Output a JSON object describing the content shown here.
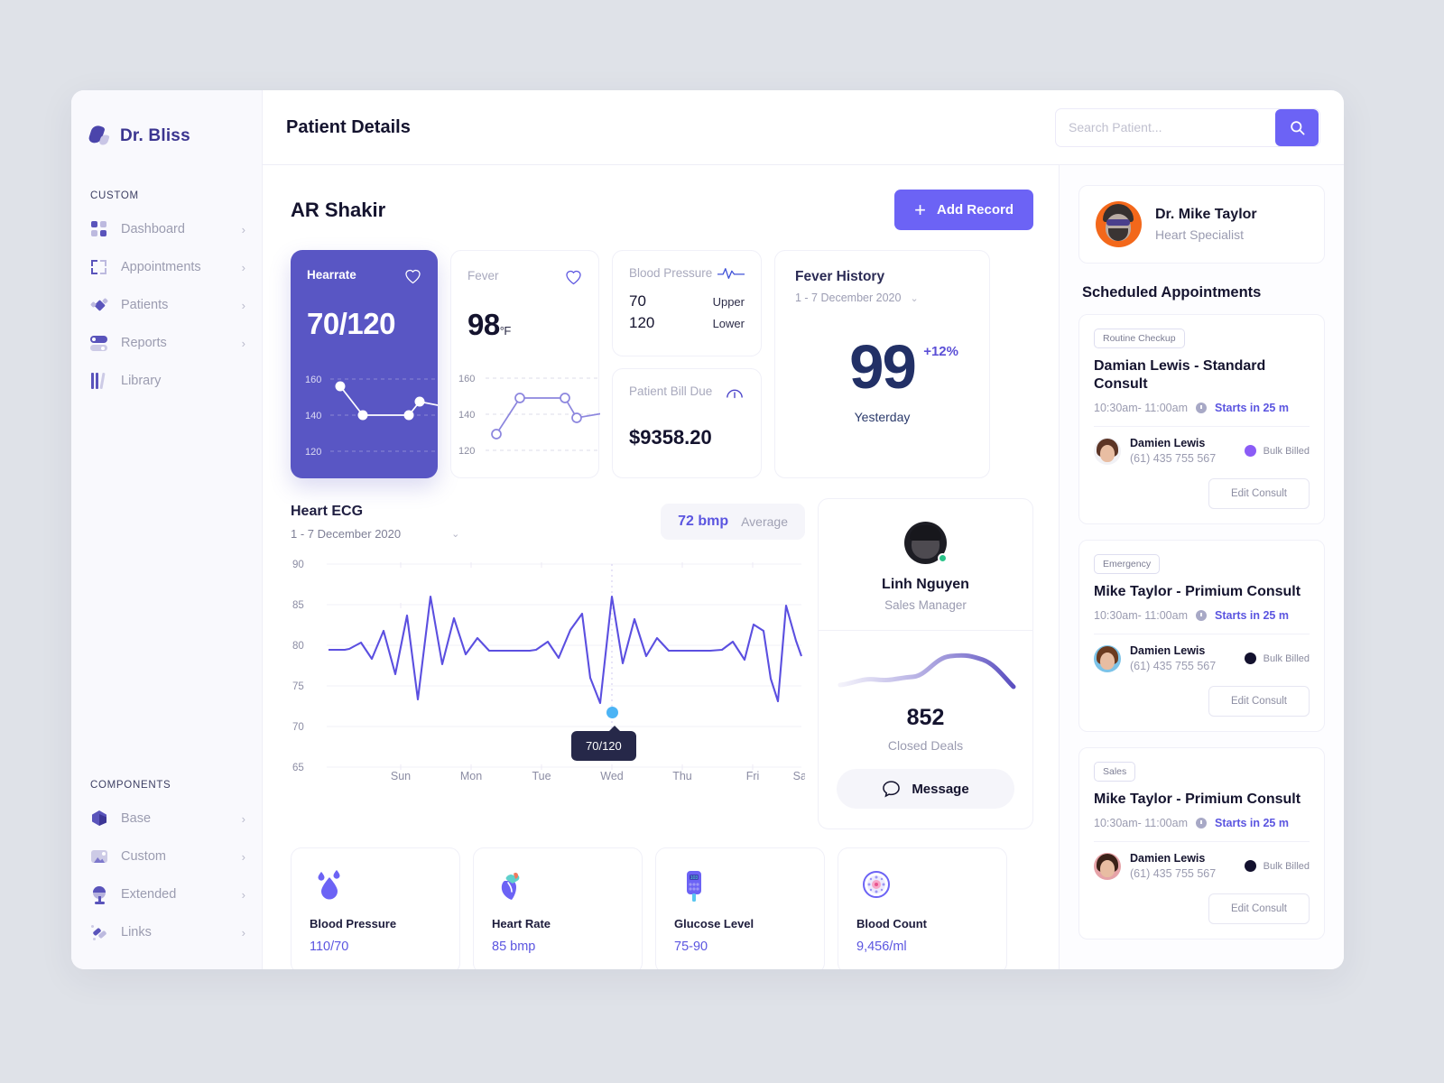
{
  "brand": {
    "name": "Dr. Bliss",
    "logo_icon": "leaf-logo-icon"
  },
  "sidebar": {
    "group1_label": "CUSTOM",
    "group1_items": [
      {
        "label": "Dashboard",
        "icon": "grid-icon",
        "chevron": "›"
      },
      {
        "label": "Appointments",
        "icon": "frame-icon",
        "chevron": "›"
      },
      {
        "label": "Patients",
        "icon": "diamond-icon",
        "chevron": "›"
      },
      {
        "label": "Reports",
        "icon": "toggle-icon",
        "chevron": "›"
      },
      {
        "label": "Library",
        "icon": "books-icon",
        "chevron": ""
      }
    ],
    "group2_label": "COMPONENTS",
    "group2_items": [
      {
        "label": "Base",
        "icon": "cube-icon",
        "chevron": "›"
      },
      {
        "label": "Custom",
        "icon": "image-icon",
        "chevron": "›"
      },
      {
        "label": "Extended",
        "icon": "mirror-icon",
        "chevron": "›"
      },
      {
        "label": "Links",
        "icon": "link-icon",
        "chevron": "›"
      }
    ]
  },
  "header": {
    "title": "Patient Details",
    "search_placeholder": "Search Patient...",
    "search_value": "",
    "search_icon": "search-icon"
  },
  "patient": {
    "name": "AR Shakir",
    "add_record_label": "Add Record",
    "add_record_icon": "plus-icon"
  },
  "stats": {
    "heartrate": {
      "title": "Hearrate",
      "icon": "heart-icon",
      "value": "70/120",
      "y_ticks": [
        "160",
        "140",
        "120"
      ]
    },
    "fever": {
      "title": "Fever",
      "icon": "heart-icon",
      "value": "98",
      "unit": "°F",
      "y_ticks": [
        "160",
        "140",
        "120"
      ]
    },
    "blood_pressure": {
      "title": "Blood Pressure",
      "icon": "pulse-icon",
      "rows": [
        {
          "value": "70",
          "label": "Upper"
        },
        {
          "value": "120",
          "label": "Lower"
        }
      ]
    },
    "patient_bill": {
      "title": "Patient Bill Due",
      "icon": "gauge-icon",
      "value": "$9358.20"
    },
    "fever_history": {
      "title": "Fever History",
      "date_range": "1 - 7 December 2020",
      "chevron": "⌄",
      "percent": "+12%",
      "value": "99",
      "caption": "Yesterday"
    }
  },
  "ecg": {
    "title": "Heart ECG",
    "date_range": "1 - 7 December 2020",
    "chevron": "⌄",
    "bpm_value": "72 bmp",
    "bpm_label": "Average",
    "tooltip": "70/120"
  },
  "chart_data": {
    "type": "line",
    "title": "Heart ECG",
    "xlabel": "",
    "ylabel": "",
    "ylim": [
      65,
      90
    ],
    "y_ticks": [
      90,
      85,
      80,
      75,
      70,
      65
    ],
    "categories": [
      "Sun",
      "Mon",
      "Tue",
      "Wed",
      "Thu",
      "Fri",
      "Sat"
    ],
    "grid": true,
    "legend": "none",
    "highlight": {
      "x_category": "Wed",
      "value": "70/120",
      "marker_color": "#4cb4f5"
    },
    "annotation": "72 bmp Average",
    "series": [
      {
        "name": "Heart ECG",
        "color": "#5b4fe0",
        "values": [
          79.4,
          79.4,
          79.5,
          80.3,
          78.3,
          81.4,
          76.4,
          83.3,
          74.1,
          84.9,
          77.6,
          82.2,
          78.9,
          80.8,
          79.3,
          79.3,
          79.3,
          79.3,
          80.3,
          78.4,
          81.5,
          76.3,
          83.7,
          73.8,
          84.9,
          77.7,
          82.1,
          78.6,
          80.8,
          79.3,
          79.3,
          79.3,
          79.3,
          79.3,
          80.3,
          78.7,
          81.9,
          76.3,
          83.4,
          74.0,
          84.4,
          78.1
        ]
      }
    ]
  },
  "linh": {
    "name": "Linh Nguyen",
    "role": "Sales Manager",
    "avatar_icon": "avatar",
    "status_icon": "online-dot-icon",
    "deals_value": "852",
    "deals_label": "Closed Deals",
    "message_label": "Message",
    "message_icon": "chat-icon",
    "sparkline": {
      "type": "area",
      "values": [
        30,
        31,
        33,
        31,
        32,
        30,
        31,
        34,
        42,
        48,
        49,
        47,
        38,
        30
      ],
      "color": "#6f63c9"
    }
  },
  "metrics": [
    {
      "label": "Blood Pressure",
      "value": "110/70",
      "icon": "blood-drop-icon"
    },
    {
      "label": "Heart Rate",
      "value": "85 bmp",
      "icon": "heart-organ-icon"
    },
    {
      "label": "Glucose Level",
      "value": "75-90",
      "icon": "glucometer-icon"
    },
    {
      "label": "Blood Count",
      "value": "9,456/ml",
      "icon": "blood-cell-icon"
    }
  ],
  "doctor": {
    "name": "Dr. Mike Taylor",
    "specialty": "Heart Specialist",
    "avatar_icon": "avatar"
  },
  "appointments": {
    "section_title": "Scheduled Appointments",
    "items": [
      {
        "tag": "Routine Checkup",
        "title": "Damian Lewis - Standard Consult",
        "time": "10:30am- 11:00am",
        "starts": "Starts in 25 m",
        "clock_icon": "clock-icon",
        "patient_name": "Damien Lewis",
        "patient_phone": "(61) 435 755 567",
        "billing_label": "Bulk Billed",
        "billing_color": "#8b5cf6",
        "edit_label": "Edit Consult",
        "avatar_hair": "#5c3526",
        "avatar_bg": "#f1f1f5"
      },
      {
        "tag": "Emergency",
        "title": "Mike Taylor - Primium Consult",
        "time": "10:30am- 11:00am",
        "starts": "Starts in 25 m",
        "clock_icon": "clock-icon",
        "patient_name": "Damien Lewis",
        "patient_phone": "(61) 435 755 567",
        "billing_label": "Bulk Billed",
        "billing_color": "#13112e",
        "edit_label": "Edit Consult",
        "avatar_hair": "#6b3a1f",
        "avatar_bg": "#7cc3e8"
      },
      {
        "tag": "Sales",
        "title": "Mike Taylor - Primium Consult",
        "time": "10:30am- 11:00am",
        "starts": "Starts in 25 m",
        "clock_icon": "clock-icon",
        "patient_name": "Damien Lewis",
        "patient_phone": "(61) 435 755 567",
        "billing_label": "Bulk Billed",
        "billing_color": "#13112e",
        "edit_label": "Edit Consult",
        "avatar_hair": "#3b2218",
        "avatar_bg": "#e6a3a8"
      }
    ]
  },
  "colors": {
    "accent": "#6c63f5",
    "card_purple": "#5956c4",
    "line_purple": "#5b4fe0",
    "dark": "#14132e",
    "muted": "#9a9bb0",
    "highlight_blue": "#4cb4f5"
  }
}
